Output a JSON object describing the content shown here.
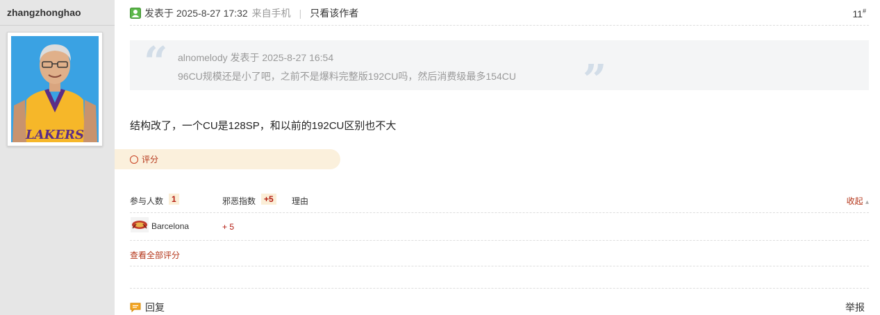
{
  "user": {
    "username": "zhangzhonghao",
    "avatar_alt": "LAKERS"
  },
  "post": {
    "posted_label": "发表于 2025-8-27 17:32",
    "from_label": "来自手机",
    "author_only_label": "只看该作者",
    "floor": "11",
    "floor_mark": "#",
    "body": "结构改了，一个CU是128SP，和以前的192CU区别也不大"
  },
  "quote": {
    "header": "alnomelody 发表于 2025-8-27 16:54",
    "text": "96CU规模还是小了吧，之前不是爆料完整版192CU吗，然后消费级最多154CU",
    "open_mark": "“",
    "close_mark": "”"
  },
  "rating": {
    "bar_label": "评分",
    "participants_label": "参与人数",
    "participants_count": "1",
    "evil_label": "邪恶指数",
    "evil_total": "+5",
    "reason_label": "理由",
    "collapse_label": "收起",
    "collapse_arrow": "▴",
    "entries": [
      {
        "name": "Barcelona",
        "score": "+ 5"
      }
    ],
    "view_all_label": "查看全部评分"
  },
  "footer": {
    "reply_label": "回复",
    "report_label": "举报"
  },
  "colors": {
    "accent_red": "#b4361a",
    "rate_bar_bg": "#fbf0dc",
    "quote_bg": "#f4f5f6",
    "sidebar_bg": "#e6e6e6"
  }
}
